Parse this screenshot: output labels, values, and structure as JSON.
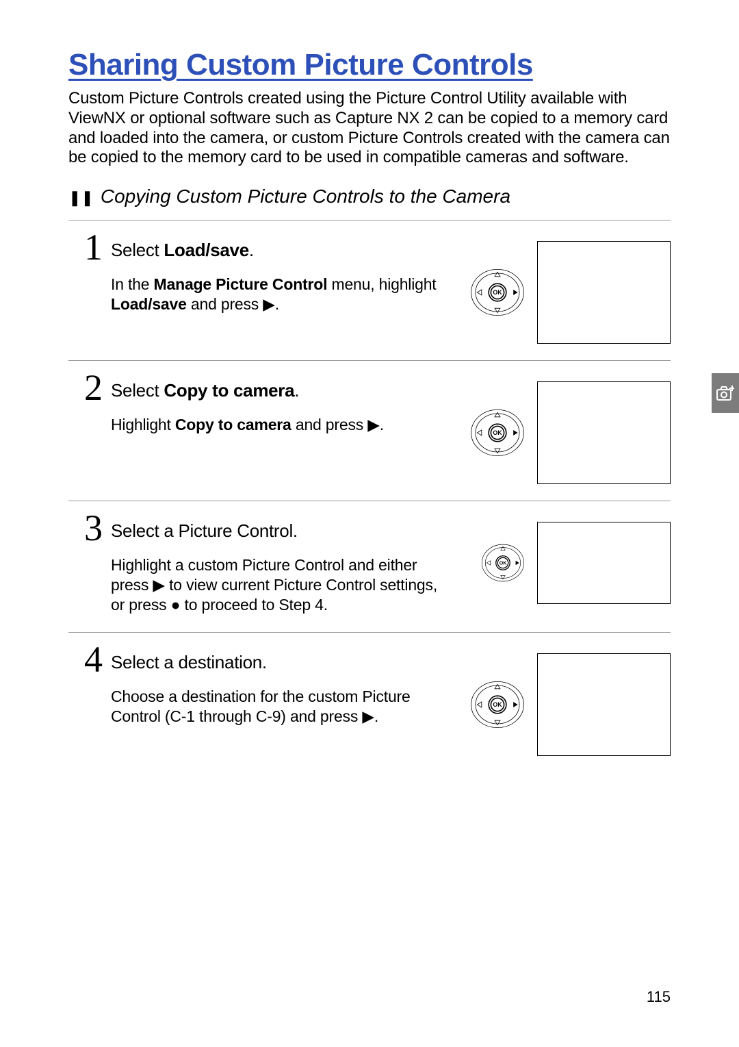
{
  "title": "Sharing Custom Picture Controls",
  "intro": "Custom Picture Controls created using the Picture Control Utility available with ViewNX or optional software such as Capture NX 2 can be copied to a memory card and loaded into the camera, or custom Picture Controls created with the camera can be copied to the memory card to be used in compatible cameras and software.",
  "section": {
    "bullet": "❚❚",
    "heading": "Copying Custom Picture Controls to the Camera"
  },
  "steps": [
    {
      "num": "1",
      "title_pre": "Select",
      "title_bold": "Load/save",
      "title_post": ".",
      "desc_html": "In the <b>Manage Picture Control</b> menu, highlight <b>Load/save</b> and press ▶."
    },
    {
      "num": "2",
      "title_pre": "Select",
      "title_bold": "Copy to camera",
      "title_post": ".",
      "desc_html": "Highlight <b>Copy to camera</b> and press ▶."
    },
    {
      "num": "3",
      "title_pre": "Select a Picture Control.",
      "title_bold": "",
      "title_post": "",
      "desc_html": "Highlight a custom Picture Control and either press ▶ to view current Picture Control settings, or press ● to proceed to Step 4."
    },
    {
      "num": "4",
      "title_pre": "Select a destination.",
      "title_bold": "",
      "title_post": "",
      "desc_html": "Choose a destination for the custom Picture Control (C-1 through C-9) and press ▶."
    }
  ],
  "icons": {
    "dpad_label": "OK"
  },
  "page_number": "115"
}
